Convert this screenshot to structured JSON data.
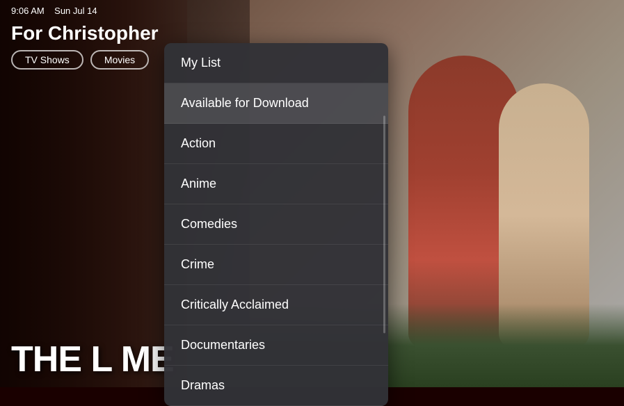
{
  "topBar": {
    "time": "9:06 AM",
    "date": "Sun Jul 14"
  },
  "pageTitle": "For Christopher",
  "navPills": [
    {
      "label": "TV Shows"
    },
    {
      "label": "Movies"
    }
  ],
  "bigTitle": "THE L     ME",
  "dropdown": {
    "items": [
      {
        "label": "My List",
        "highlighted": false
      },
      {
        "label": "Available for Download",
        "highlighted": true
      },
      {
        "label": "Action",
        "highlighted": false
      },
      {
        "label": "Anime",
        "highlighted": false
      },
      {
        "label": "Comedies",
        "highlighted": false
      },
      {
        "label": "Crime",
        "highlighted": false
      },
      {
        "label": "Critically Acclaimed",
        "highlighted": false
      },
      {
        "label": "Documentaries",
        "highlighted": false
      },
      {
        "label": "Dramas",
        "highlighted": false
      }
    ]
  }
}
